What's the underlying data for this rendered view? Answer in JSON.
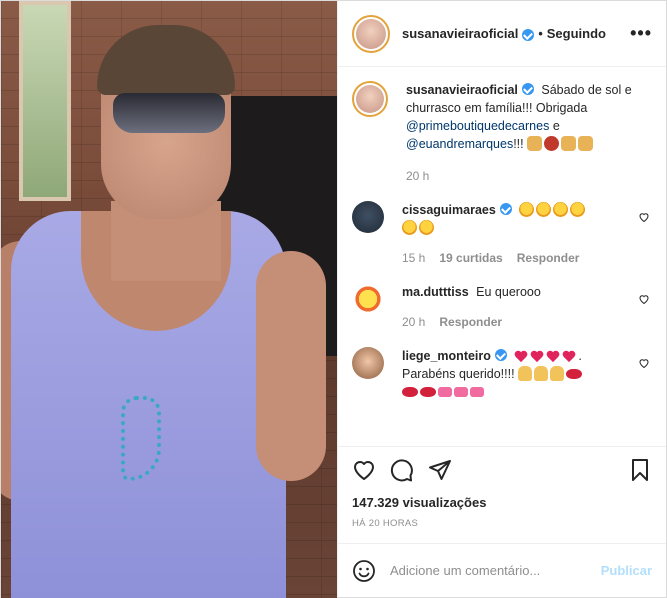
{
  "post": {
    "author": "susanavieiraoficial",
    "follow_dot": "•",
    "follow_status": "Seguindo",
    "more_label": "•••"
  },
  "caption": {
    "user": "susanavieiraoficial",
    "text_part1": "Sábado de sol e churrasco em família!!! Obrigada",
    "mention1": "@primeboutiquedecarnes",
    "text_part2": "e",
    "mention2": "@euandremarques",
    "text_part3": "!!!",
    "time": "20 h"
  },
  "comments": [
    {
      "user": "cissaguimaraes",
      "verified": true,
      "text": "",
      "emojis": [
        "star",
        "star",
        "star",
        "star",
        "star",
        "star"
      ],
      "time": "15 h",
      "likes": "19 curtidas",
      "reply": "Responder"
    },
    {
      "user": "ma.dutttiss",
      "verified": false,
      "text": "Eu querooo",
      "emojis": [],
      "time": "20 h",
      "likes": "",
      "reply": "Responder"
    },
    {
      "user": "liege_monteiro",
      "verified": true,
      "text_before": "",
      "text": ". Parabéns querido!!!!",
      "time": "",
      "likes": "",
      "reply": ""
    }
  ],
  "actions": {
    "views": "147.329 visualizações",
    "ago": "HÁ 20 HORAS"
  },
  "composer": {
    "placeholder": "Adicione um comentário...",
    "publish": "Publicar"
  },
  "colors": {
    "verified": "#3897f0",
    "publish": "#b2dffc",
    "link": "#00376b"
  }
}
